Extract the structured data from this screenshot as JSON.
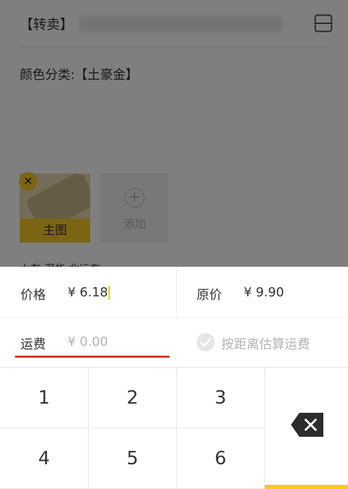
{
  "background_page": {
    "title_prefix": "【转卖】",
    "description": "颜色分类:【土豪金】",
    "images": [
      {
        "label": "主图",
        "remove_icon": "close-icon"
      }
    ],
    "add_image_label": "添加",
    "location_text": "火车·深华·北运东"
  },
  "price_sheet": {
    "price_label": "价格",
    "price_value": "¥ 6.18",
    "original_price_label": "原价",
    "original_price_value": "¥ 9.90",
    "shipping_label": "运费",
    "shipping_placeholder": "¥ 0.00",
    "estimate_shipping_label": "按距离估算运费"
  },
  "keypad": {
    "keys": [
      "1",
      "2",
      "3",
      "4",
      "5",
      "6"
    ],
    "delete_icon": "backspace-icon"
  },
  "colors": {
    "accent": "#f6ca24",
    "annotation_underline": "#d63a2b",
    "overlay": "#7f7f7f"
  }
}
